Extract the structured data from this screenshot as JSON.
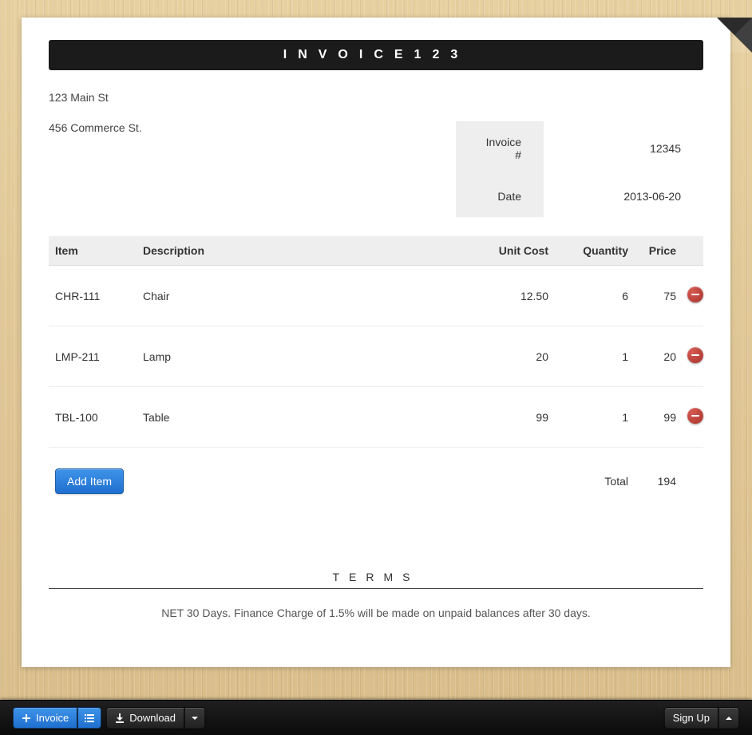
{
  "header": {
    "title": "INVOICE123"
  },
  "seller_address": "123 Main St",
  "buyer_address": "456 Commerce St.",
  "meta": {
    "invoice_no_label": "Invoice #",
    "invoice_no": "12345",
    "date_label": "Date",
    "date": "2013-06-20"
  },
  "columns": {
    "item": "Item",
    "description": "Description",
    "unit_cost": "Unit Cost",
    "quantity": "Quantity",
    "price": "Price"
  },
  "line_items": [
    {
      "item": "CHR-111",
      "description": "Chair",
      "unit_cost": "12.50",
      "quantity": "6",
      "price": "75"
    },
    {
      "item": "LMP-211",
      "description": "Lamp",
      "unit_cost": "20",
      "quantity": "1",
      "price": "20"
    },
    {
      "item": "TBL-100",
      "description": "Table",
      "unit_cost": "99",
      "quantity": "1",
      "price": "99"
    }
  ],
  "add_item_label": "Add Item",
  "totals": {
    "label": "Total",
    "value": "194"
  },
  "terms": {
    "heading": "TERMS",
    "text": "NET 30 Days. Finance Charge of 1.5% will be made on unpaid balances after 30 days."
  },
  "footer": {
    "invoice_btn": "Invoice",
    "download_btn": "Download",
    "signup_btn": "Sign Up"
  }
}
